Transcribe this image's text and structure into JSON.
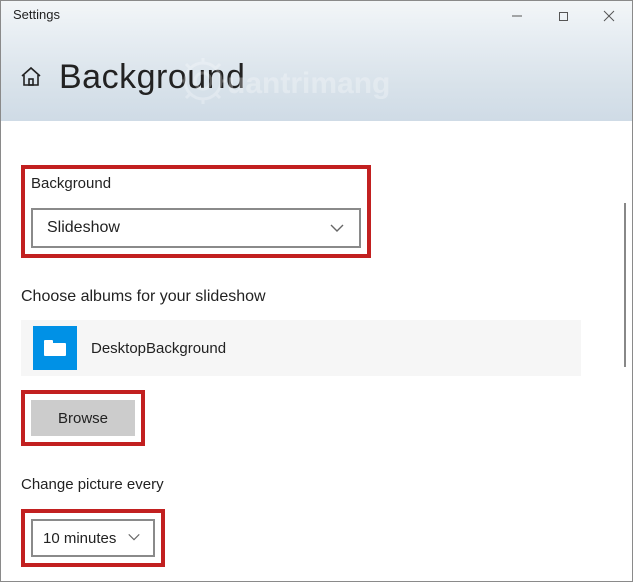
{
  "window": {
    "title": "Settings"
  },
  "header": {
    "page_title": "Background"
  },
  "watermark": {
    "text": "uantrimang"
  },
  "background_section": {
    "label": "Background",
    "dropdown_value": "Slideshow"
  },
  "albums_section": {
    "label": "Choose albums for your slideshow",
    "selected_folder": "DesktopBackground",
    "browse_label": "Browse"
  },
  "change_section": {
    "label": "Change picture every",
    "dropdown_value": "10 minutes"
  },
  "colors": {
    "highlight": "#c22020",
    "folder_tile": "#0091e6"
  }
}
